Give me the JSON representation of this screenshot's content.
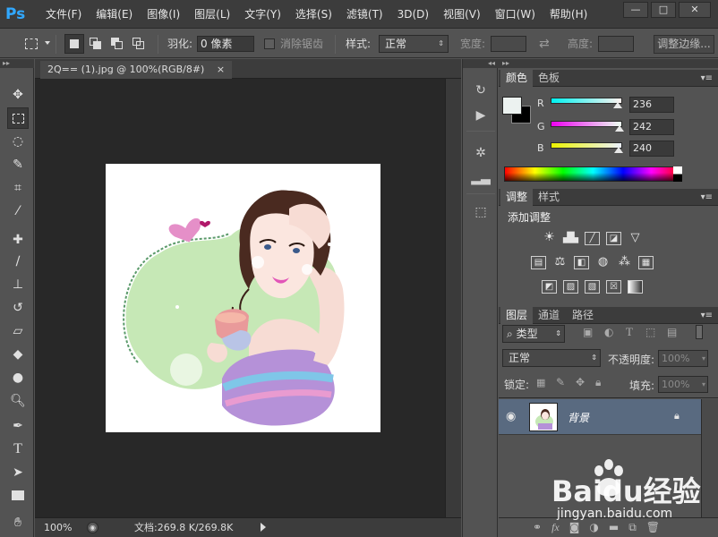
{
  "app": {
    "logo": "Ps"
  },
  "menu": [
    "文件(F)",
    "编辑(E)",
    "图像(I)",
    "图层(L)",
    "文字(Y)",
    "选择(S)",
    "滤镜(T)",
    "3D(D)",
    "视图(V)",
    "窗口(W)",
    "帮助(H)"
  ],
  "window_controls": {
    "minimize": "—",
    "maximize": "□",
    "close": "✕"
  },
  "options": {
    "feather_label": "羽化:",
    "feather_value": "0 像素",
    "antialias_label": "消除锯齿",
    "style_label": "样式:",
    "style_value": "正常",
    "width_label": "宽度:",
    "height_label": "高度:",
    "refine_button": "调整边缘..."
  },
  "document": {
    "tab_title": "2Q== (1).jpg @ 100%(RGB/8#)",
    "tab_close": "×",
    "zoom": "100%",
    "doc_info": "文档:269.8 K/269.8K"
  },
  "color_panel": {
    "tabs": [
      "颜色",
      "色板"
    ],
    "r_label": "R",
    "r_value": "236",
    "g_label": "G",
    "g_value": "242",
    "b_label": "B",
    "b_value": "240",
    "foreground": "#ecf2f0",
    "background": "#000000"
  },
  "adjust_panel": {
    "tabs": [
      "调整",
      "样式"
    ],
    "title": "添加调整"
  },
  "layers_panel": {
    "tabs": [
      "图层",
      "通道",
      "路径"
    ],
    "filter_kind": "类型",
    "blend_mode": "正常",
    "opacity_label": "不透明度:",
    "opacity_value": "100%",
    "lock_label": "锁定:",
    "fill_label": "填充:",
    "fill_value": "100%",
    "layers": [
      {
        "name": "背景",
        "locked": true,
        "visible": true
      }
    ]
  },
  "watermark": {
    "brand": "Baidu经验",
    "url": "jingyan.baidu.com"
  },
  "colors": {
    "accent": "#31a8ff",
    "selected_layer": "#596a80"
  }
}
